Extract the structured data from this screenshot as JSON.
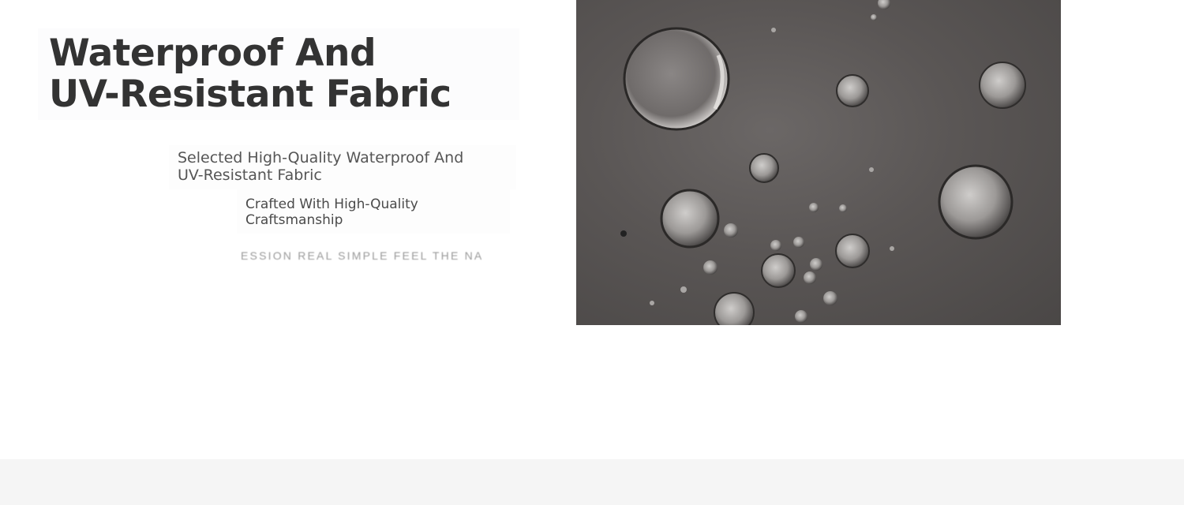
{
  "feature": {
    "heading_line1": "Waterproof And",
    "heading_line2": "UV-Resistant Fabric",
    "subheading_line1": "Selected High-Quality Waterproof And",
    "subheading_line2": "UV-Resistant Fabric",
    "detail_line1": "Crafted With High-Quality",
    "detail_line2": "Craftsmanship",
    "tagline": "ESSION REAL SIMPLE FEEL THE NA"
  },
  "colors": {
    "heading": "#333333",
    "subheading": "#555555",
    "tagline": "#9a9a9a",
    "footer_band": "#f5f5f5"
  }
}
